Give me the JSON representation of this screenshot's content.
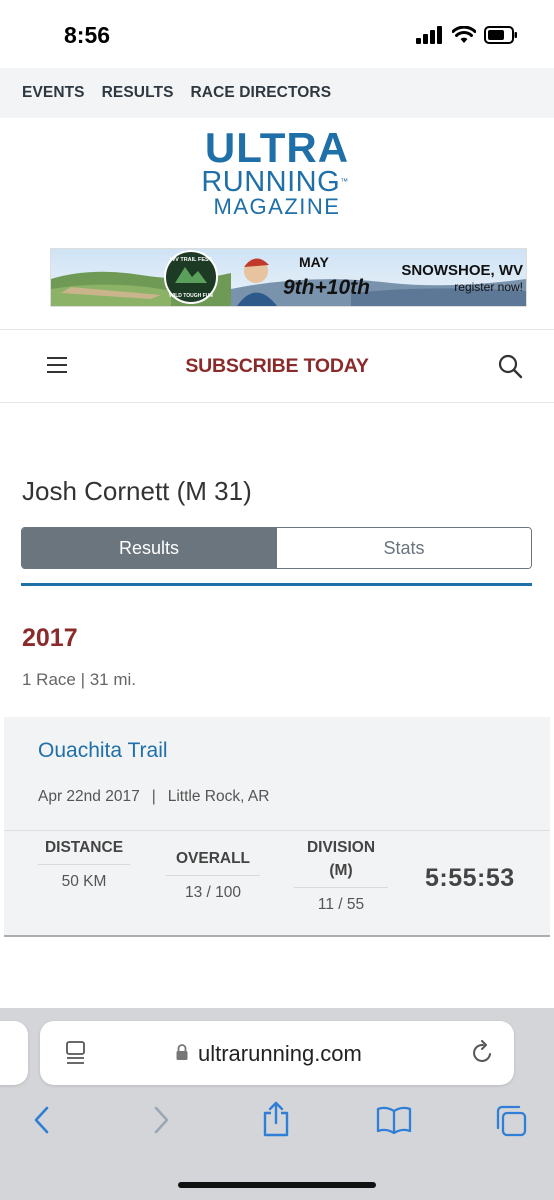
{
  "status_bar": {
    "time": "8:56"
  },
  "top_nav": {
    "items": [
      "EVENTS",
      "RESULTS",
      "RACE DIRECTORS"
    ]
  },
  "logo": {
    "line1": "ULTRA",
    "line2": "RUNNING",
    "line3": "MAGAZINE"
  },
  "banner": {
    "badge_top": "WV TRAIL FEST",
    "badge_bottom": "WILD TOUGH FUN",
    "date_line": "MAY",
    "date_main": "9th+10th",
    "location": "SNOWSHOE, WV",
    "cta": "register now!"
  },
  "subscribe": {
    "label": "SUBSCRIBE TODAY"
  },
  "profile": {
    "name": "Josh Cornett (M 31)",
    "tabs": [
      "Results",
      "Stats"
    ],
    "active_tab": "Results"
  },
  "year_section": {
    "year": "2017",
    "summary": "1 Race | 31 mi."
  },
  "race": {
    "name": "Ouachita Trail",
    "date": "Apr 22nd 2017",
    "separator": "|",
    "location": "Little Rock, AR",
    "stats": [
      {
        "label": "DISTANCE",
        "value": "50 KM"
      },
      {
        "label": "OVERALL",
        "value": "13 / 100"
      },
      {
        "label": "DIVISION (M)",
        "value": "11 / 55"
      }
    ],
    "finish_time": "5:55:53"
  },
  "browser": {
    "url": "ultrarunning.com"
  },
  "colors": {
    "brand_blue": "#1f6fa8",
    "brand_red": "#8a2a2a",
    "ios_blue": "#2f7fd6",
    "tab_gray": "#6b757e"
  }
}
